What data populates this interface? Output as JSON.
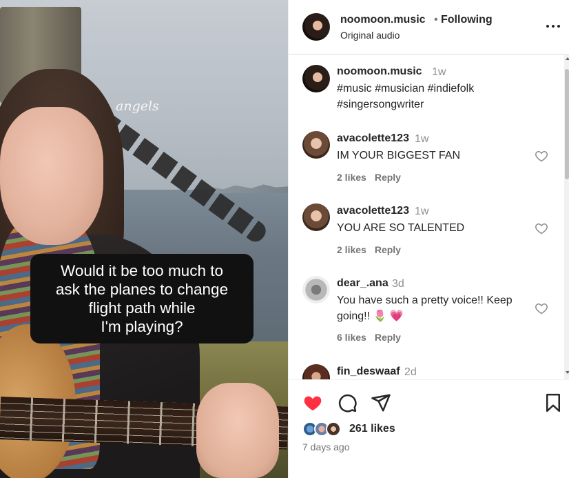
{
  "post": {
    "caption_overlay": "Would it be too much to\nask the planes to change\nflight path while\nI'm playing?",
    "watermark": "angels"
  },
  "header": {
    "username": "noomoon.music",
    "separator": "•",
    "follow_status": "Following",
    "audio": "Original audio"
  },
  "caption": {
    "username": "noomoon.music",
    "time": "1w",
    "hashtags_line1": "#music #musician #indiefolk",
    "hashtags_line2": "#singersongwriter"
  },
  "comments": [
    {
      "username": "avacolette123",
      "time": "1w",
      "text": "IM YOUR BIGGEST FAN",
      "likes": "2 likes",
      "reply": "Reply"
    },
    {
      "username": "avacolette123",
      "time": "1w",
      "text": "YOU ARE SO TALENTED",
      "likes": "2 likes",
      "reply": "Reply"
    },
    {
      "username": "dear_.ana",
      "time": "3d",
      "text": "You have such a pretty voice!! Keep going!! 🌷 💗",
      "likes": "6 likes",
      "reply": "Reply"
    },
    {
      "username": "fin_deswaaf",
      "time": "2d"
    }
  ],
  "footer": {
    "likes": "261 likes",
    "time_ago": "7 days ago"
  },
  "icons": {
    "more": "more-options-icon",
    "like": "heart-filled-icon",
    "comment": "comment-icon",
    "share": "share-icon",
    "save": "bookmark-icon",
    "comment_like": "heart-outline-icon"
  },
  "colors": {
    "heart_active": "#ff3040",
    "hashtag": "#00376b",
    "muted": "#737373"
  }
}
